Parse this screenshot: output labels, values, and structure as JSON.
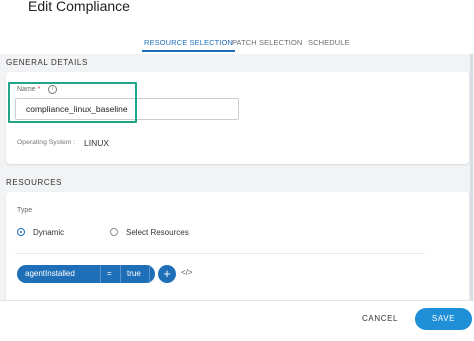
{
  "header": {
    "title": "Edit Compliance"
  },
  "tabs": [
    {
      "label": "RESOURCE SELECTION",
      "active": true
    },
    {
      "label": "PATCH SELECTION",
      "active": false
    },
    {
      "label": "SCHEDULE",
      "active": false
    }
  ],
  "general": {
    "section_title": "GENERAL DETAILS",
    "name_label": "Name",
    "required_mark": "*",
    "info_glyph": "i",
    "name_value": "compliance_linux_baseline",
    "os_label": "Operating System :",
    "os_value": "LINUX"
  },
  "resources": {
    "section_title": "RESOURCES",
    "type_label": "Type",
    "options": [
      {
        "label": "Dynamic",
        "checked": true
      },
      {
        "label": "Select Resources",
        "checked": false
      }
    ],
    "filter": {
      "field": "agentInstalled",
      "operator": "=",
      "value": "true",
      "remove_glyph": "✕"
    },
    "add_glyph": "+",
    "code_glyph": "</>"
  },
  "footer": {
    "cancel_label": "CANCEL",
    "save_label": "SAVE"
  },
  "colors": {
    "accent": "#1f6fb8",
    "save": "#1f8fd8",
    "highlight": "#21a58a"
  }
}
